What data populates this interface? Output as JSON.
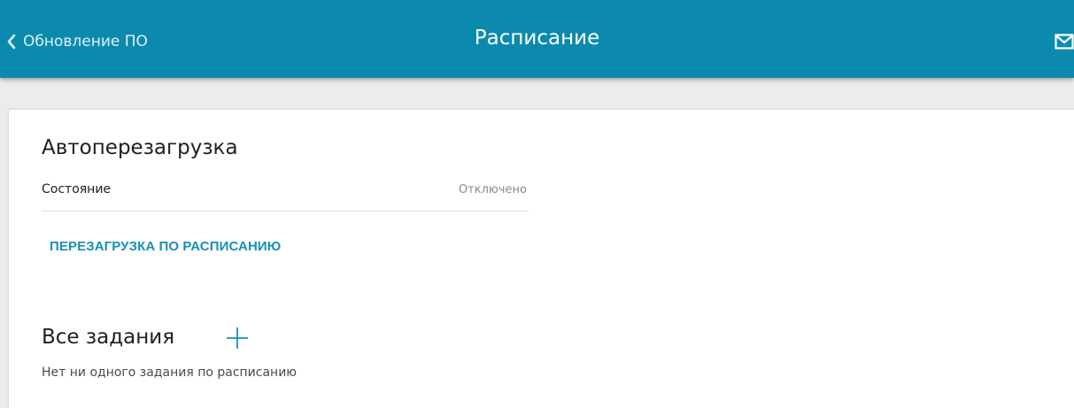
{
  "header": {
    "back_label": "Обновление ПО",
    "title": "Расписание",
    "back_icon": "chevron-left-icon",
    "mail_icon": "mail-icon",
    "color": "#0c8aae"
  },
  "autoreboot": {
    "title": "Автоперезагрузка",
    "status_label": "Состояние",
    "status_value": "Отключено",
    "schedule_link": "ПЕРЕЗАГРУЗКА ПО РАСПИСАНИЮ",
    "link_color": "#1a8fb4"
  },
  "tasks": {
    "title": "Все задания",
    "add_icon": "plus-icon",
    "empty_message": "Нет ни одного задания по расписанию"
  }
}
